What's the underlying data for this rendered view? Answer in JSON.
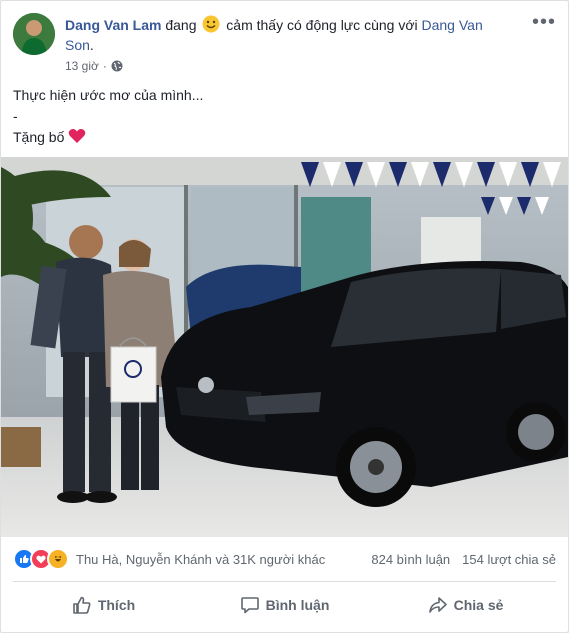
{
  "post": {
    "author": "Dang Van Lam",
    "feeling_prefix": "đang",
    "feeling_text": "cảm thấy có động lực cùng với",
    "tagged": "Dang Van Son",
    "tagged_end": ".",
    "time": "13 giờ",
    "line1": "Thực hiện ước mơ của mình...",
    "line2": "-",
    "line3": "Tặng bố"
  },
  "stats": {
    "reactors": "Thu Hà, Nguyễn Khánh và 31K người khác",
    "comments": "824 bình luận",
    "shares": "154 lượt chia sẻ"
  },
  "actions": {
    "like": "Thích",
    "comment": "Bình luận",
    "share": "Chia sẻ"
  },
  "colors": {
    "link": "#385898",
    "like": "#1877f2",
    "love": "#f33e58",
    "haha": "#f7b125"
  }
}
